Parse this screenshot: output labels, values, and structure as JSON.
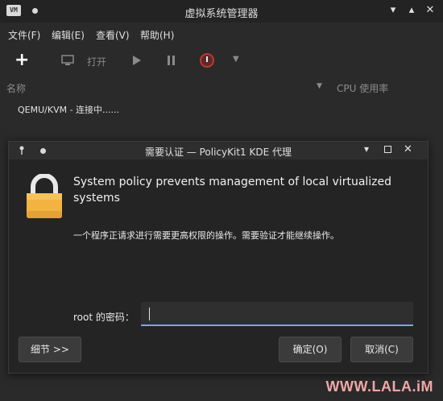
{
  "window": {
    "title": "虚拟系统管理器",
    "app_icon_text": "VM"
  },
  "menu": [
    "文件(F)",
    "编辑(E)",
    "查看(V)",
    "帮助(H)"
  ],
  "toolbar": {
    "open_label": "打开"
  },
  "columns": {
    "name": "名称",
    "cpu": "CPU 使用率"
  },
  "list": {
    "connection": "QEMU/KVM - 连接中......"
  },
  "dialog": {
    "title": "需要认证 — PolicyKit1 KDE 代理",
    "heading": "System policy prevents management of local virtualized systems",
    "message": "一个程序正请求进行需要更高权限的操作。需要验证才能继续操作。",
    "password_label": "root 的密码：",
    "password_value": "",
    "details_button": "细节 >>",
    "ok_button": "确定(O)",
    "cancel_button": "取消(C)"
  },
  "watermark": "WWW.LALA.iM",
  "colors": {
    "accent": "#7fa5e0",
    "lock_body": "#f2b341",
    "stop_red": "#c0392b"
  }
}
